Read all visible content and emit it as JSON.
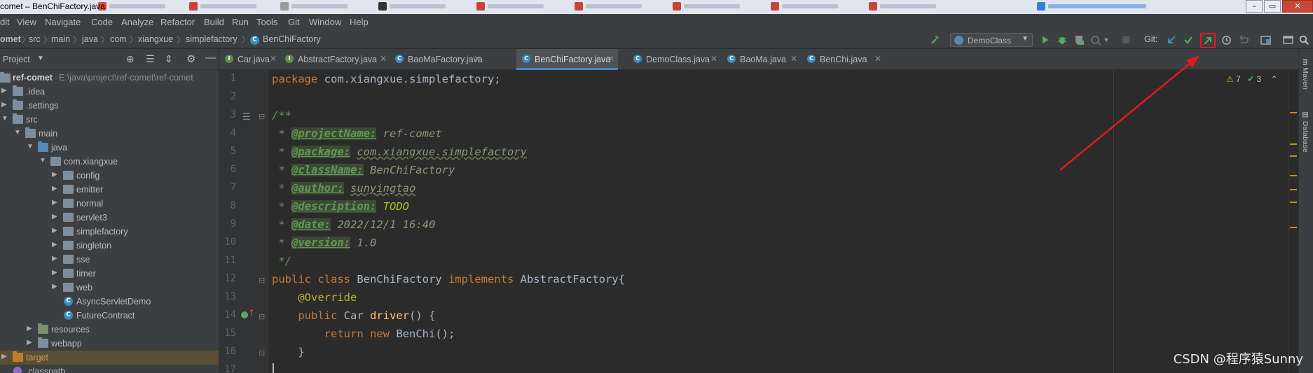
{
  "window": {
    "title": "comet – BenChiFactory.java",
    "controls": [
      "–",
      "▭",
      "✕"
    ]
  },
  "menu": [
    "dit",
    "View",
    "Navigate",
    "Code",
    "Analyze",
    "Refactor",
    "Build",
    "Run",
    "Tools",
    "Git",
    "Window",
    "Help"
  ],
  "breadcrumb": [
    "omet",
    "src",
    "main",
    "java",
    "com",
    "xiangxue",
    "simplefactory",
    "BenChiFactory"
  ],
  "toolbar": {
    "run_config": "DemoClass",
    "git_label": "Git:"
  },
  "project": {
    "title": "Project",
    "root_name": "ref-comet",
    "root_path": "E:\\java\\project\\ref-comet\\ref-comet",
    "tree": [
      {
        "label": ".idea"
      },
      {
        "label": ".settings"
      },
      {
        "label": "src"
      },
      {
        "label": "main"
      },
      {
        "label": "java"
      },
      {
        "label": "com.xiangxue"
      },
      {
        "label": "config"
      },
      {
        "label": "emitter"
      },
      {
        "label": "normal"
      },
      {
        "label": "servlet3"
      },
      {
        "label": "simplefactory"
      },
      {
        "label": "singleton"
      },
      {
        "label": "sse"
      },
      {
        "label": "timer"
      },
      {
        "label": "web"
      },
      {
        "label": "AsyncServletDemo"
      },
      {
        "label": "FutureContract"
      },
      {
        "label": "resources"
      },
      {
        "label": "webapp"
      },
      {
        "label": "target"
      },
      {
        "label": ".classpath"
      }
    ]
  },
  "tabs": [
    {
      "label": "Car.java",
      "icon": "I"
    },
    {
      "label": "AbstractFactory.java",
      "icon": "I"
    },
    {
      "label": "BaoMaFactory.java",
      "icon": "C"
    },
    {
      "label": "BenChiFactory.java",
      "icon": "C"
    },
    {
      "label": "DemoClass.java",
      "icon": "C"
    },
    {
      "label": "BaoMa.java",
      "icon": "C"
    },
    {
      "label": "BenChi.java",
      "icon": "C"
    }
  ],
  "line_numbers": [
    "1",
    "2",
    "3",
    "4",
    "5",
    "6",
    "7",
    "8",
    "9",
    "10",
    "11",
    "12",
    "13",
    "14",
    "15",
    "16",
    "17"
  ],
  "code": {
    "l1_kw": "package",
    "l1_rest": " com.xiangxue.simplefactory;",
    "l3": "/**",
    "star": " * ",
    "l4_tag": "@projectName:",
    "l4_val": " ref-comet",
    "l5_tag": "@package:",
    "l5_sp": " ",
    "l5_val": "com.xiangxue.simplefactory",
    "l6_tag": "@className:",
    "l6_val": " BenChiFactory",
    "l7_tag": "@author:",
    "l7_sp": " ",
    "l7_val": "sunyingtao",
    "l8_tag": "@description:",
    "l8_val": " TODO",
    "l9_tag": "@date:",
    "l9_val": " 2022/12/1 16:40",
    "l10_tag": "@version:",
    "l10_val": " 1.0",
    "l11": " */",
    "l12_kw1": "public class",
    "l12_name": " BenChiFactory ",
    "l12_kw2": "implements",
    "l12_rest": " AbstractFactory{",
    "l13_indent": "    ",
    "l13_ann": "@Override",
    "l14_indent": "    ",
    "l14_kw": "public",
    "l14_type": " Car ",
    "l14_fn": "driver",
    "l14_rest": "() {",
    "l15_indent": "        ",
    "l15_kw1": "return",
    "l15_sp": " ",
    "l15_kw2": "new",
    "l15_rest": " BenChi();",
    "l16": "    }"
  },
  "inspections": {
    "warnings": "7",
    "checks": "3"
  },
  "side_tools": [
    "Maven",
    "Database"
  ],
  "watermark": "CSDN @程序猿Sunny",
  "colors": {
    "accent": "#4a88c7",
    "highlight": "#e11b1b"
  }
}
